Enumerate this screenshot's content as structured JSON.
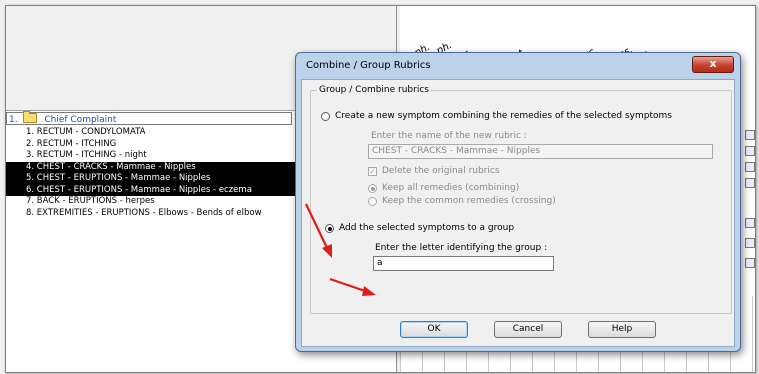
{
  "tree": {
    "header_number": "1.",
    "header_label": "Chief Complaint",
    "items": [
      {
        "text": "1. RECTUM - CONDYLOMATA",
        "selected": false
      },
      {
        "text": "2. RECTUM - ITCHING",
        "selected": false
      },
      {
        "text": "3. RECTUM - ITCHING - night",
        "selected": false
      },
      {
        "text": "4. CHEST - CRACKS - Mammae - Nipples",
        "selected": true
      },
      {
        "text": "5. CHEST - ERUPTIONS - Mammae - Nipples",
        "selected": true
      },
      {
        "text": "6. CHEST - ERUPTIONS - Mammae - Nipples - eczema",
        "selected": true
      },
      {
        "text": "7. BACK - ERUPTIONS - herpes",
        "selected": false
      },
      {
        "text": "8. EXTREMITIES - ERUPTIONS - Elbows - Bends of elbow",
        "selected": false
      }
    ]
  },
  "grid": {
    "header_fragments": [
      "ph.",
      "ph.",
      "ar.",
      "ust.",
      "rc.",
      "es.",
      "s.",
      "c.",
      "s."
    ]
  },
  "dialog": {
    "title": "Combine / Group Rubrics",
    "close_label": "x",
    "group_legend": "Group / Combine rubrics",
    "option_create": "Create a new symptom combining the remedies of the selected symptoms",
    "new_rubric_prompt": "Enter the name of the new rubric :",
    "new_rubric_value": "CHEST - CRACKS - Mammae - Nipples",
    "delete_original": "Delete the original rubrics",
    "keep_all": "Keep all remedies (combining)",
    "keep_common": "Keep the common remedies (crossing)",
    "option_group": "Add the selected symptoms to a group",
    "group_letter_prompt": "Enter the letter identifying the group :",
    "group_letter_value": "a",
    "ok_label": "OK",
    "cancel_label": "Cancel",
    "help_label": "Help"
  },
  "colors": {
    "annotation_arrow": "#e11b1b",
    "selection_bg": "#000000",
    "tree_header_text": "#1a4fb0"
  },
  "icons": {
    "folder": "folder-icon",
    "close": "close-icon",
    "arrow": "red-arrow-icon"
  }
}
